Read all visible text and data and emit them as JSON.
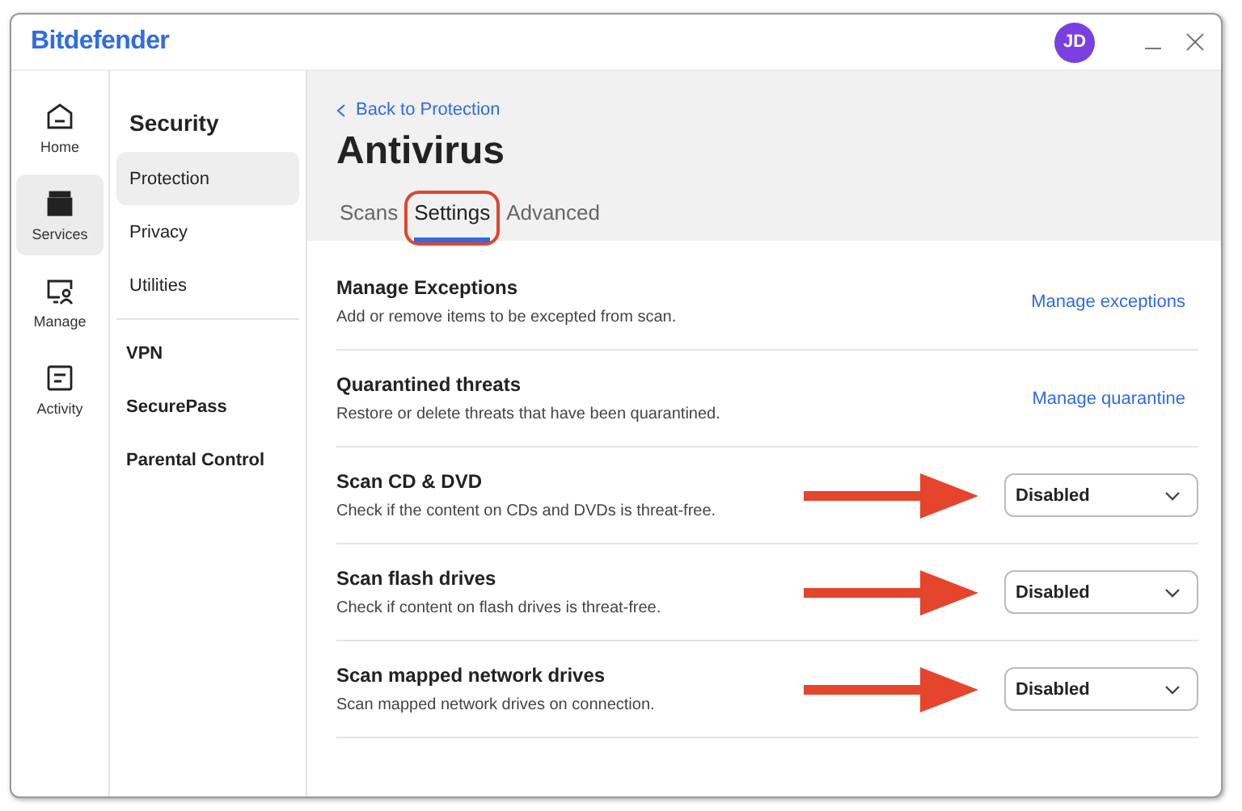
{
  "window": {
    "brand": "Bitdefender",
    "avatar": "JD"
  },
  "nav_rail": [
    {
      "label": "Home",
      "selected": false
    },
    {
      "label": "Services",
      "selected": true
    },
    {
      "label": "Manage",
      "selected": false
    },
    {
      "label": "Activity",
      "selected": false
    }
  ],
  "sidebar": {
    "heading": "Security",
    "items": [
      {
        "label": "Protection",
        "selected": true
      },
      {
        "label": "Privacy",
        "selected": false
      },
      {
        "label": "Utilities",
        "selected": false
      }
    ],
    "sections": [
      "VPN",
      "SecurePass",
      "Parental Control"
    ]
  },
  "header": {
    "back_link": "Back to Protection",
    "title": "Antivirus",
    "tabs": [
      {
        "label": "Scans",
        "selected": false,
        "circled": false
      },
      {
        "label": "Settings",
        "selected": true,
        "circled": true
      },
      {
        "label": "Advanced",
        "selected": false,
        "circled": false
      }
    ]
  },
  "settings": [
    {
      "kind": "link",
      "title": "Manage Exceptions",
      "description": "Add or remove items to be excepted from scan.",
      "action": "Manage exceptions",
      "arrow": false
    },
    {
      "kind": "link",
      "title": "Quarantined threats",
      "description": "Restore or delete threats that have been quarantined.",
      "action": "Manage quarantine",
      "arrow": false
    },
    {
      "kind": "select",
      "title": "Scan CD & DVD",
      "description": "Check if the content on CDs and DVDs is threat-free.",
      "value": "Disabled",
      "arrow": true
    },
    {
      "kind": "select",
      "title": "Scan flash drives",
      "description": "Check if content on flash drives is threat-free.",
      "value": "Disabled",
      "arrow": true
    },
    {
      "kind": "select",
      "title": "Scan mapped network drives",
      "description": "Scan mapped network drives on connection.",
      "value": "Disabled",
      "arrow": true
    }
  ]
}
